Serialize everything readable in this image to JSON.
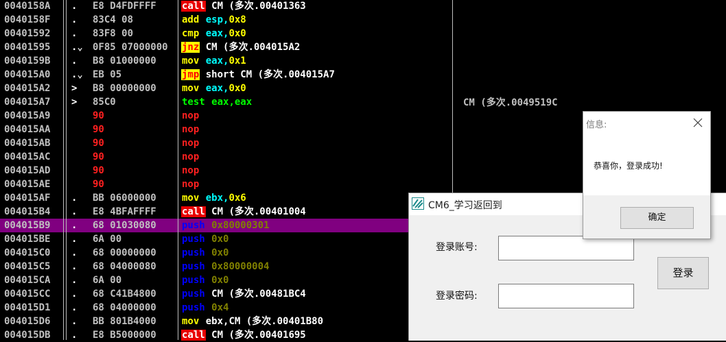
{
  "disassembly": {
    "rows": [
      {
        "addr": "0040158A",
        "mark": ".",
        "hex": "E8 D4FDFFFF",
        "mn": "call",
        "op": "CM (多次.00401363"
      },
      {
        "addr": "0040158F",
        "mark": ".",
        "hex": "83C4 08",
        "mn": "add",
        "op": "esp,0x8"
      },
      {
        "addr": "00401592",
        "mark": ".",
        "hex": "83F8 00",
        "mn": "cmp",
        "op": "eax,0x0"
      },
      {
        "addr": "00401595",
        "mark": ".⌄",
        "hex": "0F85 07000000",
        "mn": "jnz",
        "op": "CM (多次.004015A2"
      },
      {
        "addr": "0040159B",
        "mark": ".",
        "hex": "B8 01000000",
        "mn": "mov",
        "op": "eax,0x1"
      },
      {
        "addr": "004015A0",
        "mark": ".⌄",
        "hex": "EB 05",
        "mn": "jmp",
        "op": "short CM (多次.004015A7"
      },
      {
        "addr": "004015A2",
        "mark": ">",
        "hex": "B8 00000000",
        "mn": "mov",
        "op": "eax,0x0"
      },
      {
        "addr": "004015A7",
        "mark": ">",
        "hex": "85C0",
        "mn": "test",
        "op": "eax,eax"
      },
      {
        "addr": "004015A9",
        "mark": "",
        "hex": "90",
        "mn": "nop",
        "op": ""
      },
      {
        "addr": "004015AA",
        "mark": "",
        "hex": "90",
        "mn": "nop",
        "op": ""
      },
      {
        "addr": "004015AB",
        "mark": "",
        "hex": "90",
        "mn": "nop",
        "op": ""
      },
      {
        "addr": "004015AC",
        "mark": "",
        "hex": "90",
        "mn": "nop",
        "op": ""
      },
      {
        "addr": "004015AD",
        "mark": "",
        "hex": "90",
        "mn": "nop",
        "op": ""
      },
      {
        "addr": "004015AE",
        "mark": "",
        "hex": "90",
        "mn": "nop",
        "op": ""
      },
      {
        "addr": "004015AF",
        "mark": ".",
        "hex": "BB 06000000",
        "mn": "mov",
        "op": "ebx,0x6"
      },
      {
        "addr": "004015B4",
        "mark": ".",
        "hex": "E8 4BFAFFFF",
        "mn": "call",
        "op": "CM (多次.00401004"
      },
      {
        "addr": "004015B9",
        "mark": ".",
        "hex": "68 01030080",
        "mn": "push",
        "op": "0x80000301"
      },
      {
        "addr": "004015BE",
        "mark": ".",
        "hex": "6A 00",
        "mn": "push",
        "op": "0x0"
      },
      {
        "addr": "004015C0",
        "mark": ".",
        "hex": "68 00000000",
        "mn": "push",
        "op": "0x0"
      },
      {
        "addr": "004015C5",
        "mark": ".",
        "hex": "68 04000080",
        "mn": "push",
        "op": "0x80000004"
      },
      {
        "addr": "004015CA",
        "mark": ".",
        "hex": "6A 00",
        "mn": "push",
        "op": "0x0"
      },
      {
        "addr": "004015CC",
        "mark": ".",
        "hex": "68 C41B4800",
        "mn": "push",
        "op": "CM (多次.00481BC4"
      },
      {
        "addr": "004015D1",
        "mark": ".",
        "hex": "68 04000000",
        "mn": "push",
        "op": "0x4"
      },
      {
        "addr": "004015D6",
        "mark": ".",
        "hex": "BB 801B4000",
        "mn": "mov",
        "op": "ebx,CM (多次.00401B80"
      },
      {
        "addr": "004015DB",
        "mark": ".",
        "hex": "E8 B5000000",
        "mn": "call",
        "op": "CM (多次.00401695"
      }
    ],
    "selected_index": 16,
    "side_note": "CM (多次.0049519C"
  },
  "login_window": {
    "title": "CM6_学习返回到",
    "account_label": "登录账号:",
    "account_value": "",
    "password_label": "登录密码:",
    "password_value": "",
    "login_button": "登录"
  },
  "message_box": {
    "title": "信息:",
    "text": "恭喜你，登录成功!",
    "ok_button": "确定"
  }
}
